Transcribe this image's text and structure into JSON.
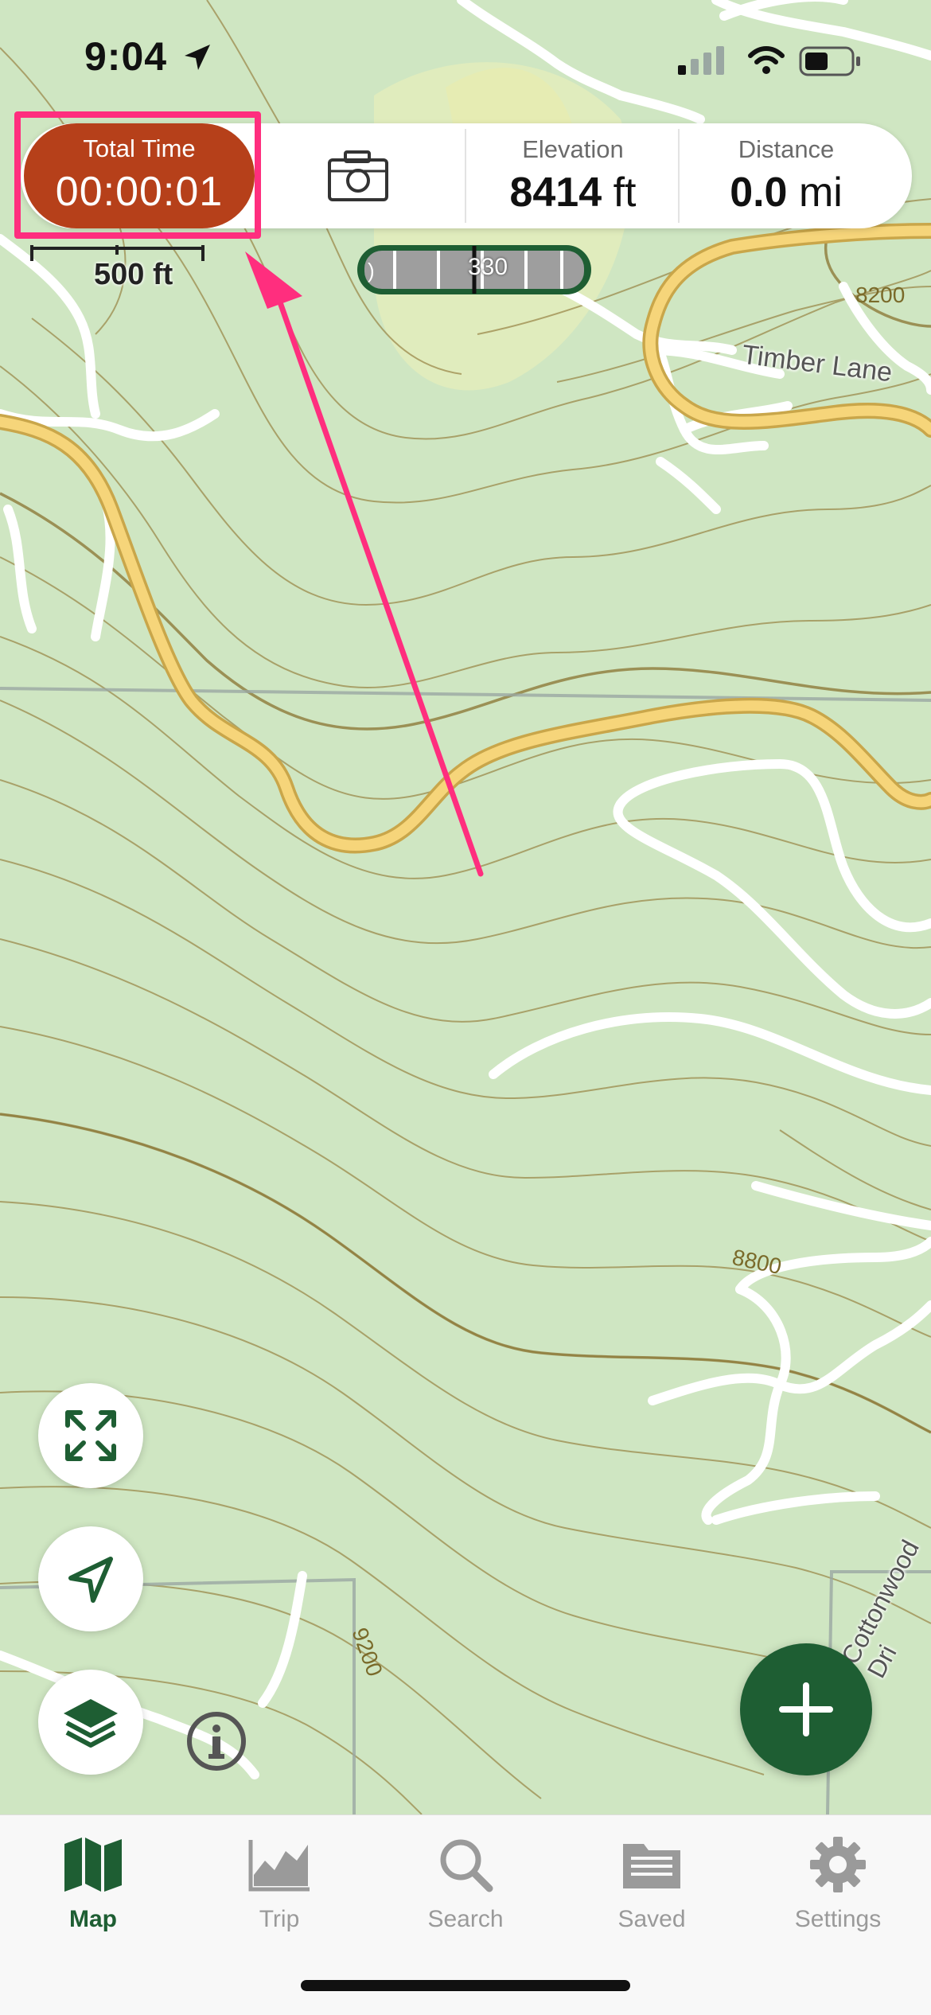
{
  "status_bar": {
    "time": "9:04",
    "icons": [
      "location-arrow-icon",
      "signal-icon",
      "wifi-icon",
      "battery-icon"
    ]
  },
  "stats": {
    "total_time_label": "Total Time",
    "total_time_value": "00:00:01",
    "elevation_label": "Elevation",
    "elevation_value": "8414",
    "elevation_unit": "ft",
    "distance_label": "Distance",
    "distance_value": "0.0",
    "distance_unit": "mi"
  },
  "map": {
    "scale_label": "500 ft",
    "heading_value": "330",
    "road_timber_lane": "Timber Lane",
    "road_cottonwood": "Cottonwood Dri",
    "contour_labels": [
      "8200",
      "8800",
      "9200"
    ]
  },
  "tabs": [
    {
      "label": "Map",
      "icon": "map-icon",
      "active": true
    },
    {
      "label": "Trip",
      "icon": "chart-icon",
      "active": false
    },
    {
      "label": "Search",
      "icon": "search-icon",
      "active": false
    },
    {
      "label": "Saved",
      "icon": "folder-icon",
      "active": false
    },
    {
      "label": "Settings",
      "icon": "gear-icon",
      "active": false
    }
  ],
  "colors": {
    "accent": "#1e5e33",
    "total_time_bg": "#b6401a",
    "annotation": "#ff2e7e",
    "map_bg": "#cfe6c2"
  }
}
